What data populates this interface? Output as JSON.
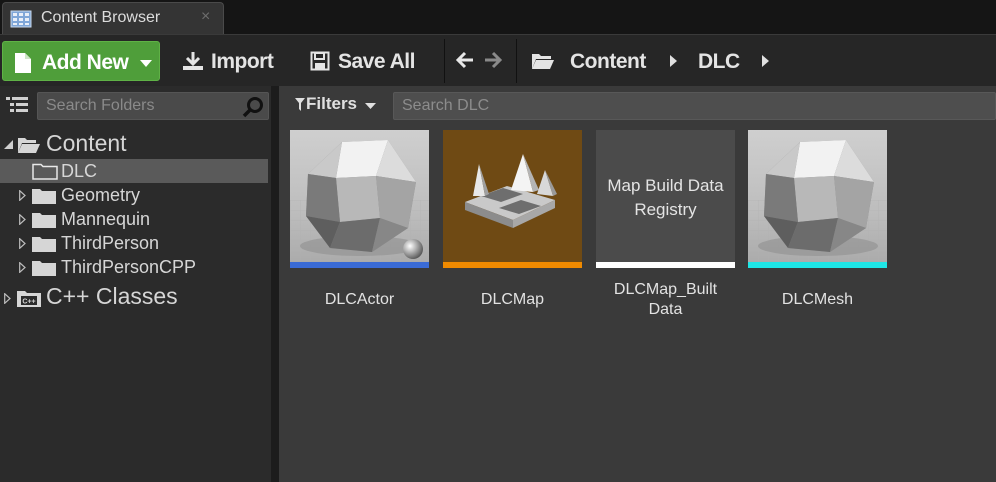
{
  "tab": {
    "title": "Content Browser",
    "close": "×"
  },
  "toolbar": {
    "add_new": "Add New",
    "import": "Import",
    "save_all": "Save All"
  },
  "breadcrumb": [
    "Content",
    "DLC"
  ],
  "left_panel": {
    "search_placeholder": "Search Folders",
    "tree": [
      {
        "label": "Content",
        "expanded": true,
        "selected": false
      },
      {
        "label": "DLC",
        "selected": true
      },
      {
        "label": "Geometry"
      },
      {
        "label": "Mannequin"
      },
      {
        "label": "ThirdPerson"
      },
      {
        "label": "ThirdPersonCPP"
      },
      {
        "label": "C++ Classes",
        "badge": "C++"
      }
    ]
  },
  "right_panel": {
    "filters_label": "Filters",
    "search_placeholder": "Search DLC",
    "assets": [
      {
        "name": "DLCActor",
        "bar_color": "#3a6bd6",
        "thumb": "mesh-with-sphere"
      },
      {
        "name": "DLCMap",
        "bar_color": "#f08a00",
        "thumb": "map"
      },
      {
        "name": "DLCMap_BuiltData",
        "display_line1": "DLCMap_Built",
        "display_line2": "Data",
        "bar_color": "#ffffff",
        "thumb_text_line1": "Map Build Data",
        "thumb_text_line2": "Registry"
      },
      {
        "name": "DLCMesh",
        "bar_color": "#1ee6e6",
        "thumb": "mesh"
      }
    ]
  },
  "colors": {
    "add_new_green": "#4f9e3a",
    "selected_row": "#5a5a5a",
    "panel_bg": "#3a3a3a"
  }
}
